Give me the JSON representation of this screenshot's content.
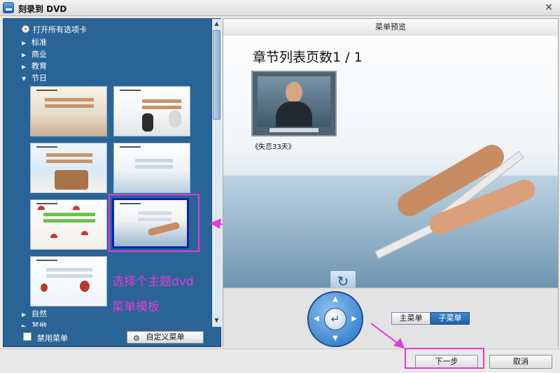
{
  "window": {
    "title": "刻录到 DVD",
    "close": "✕"
  },
  "tree": {
    "open_all": "打开所有选项卡",
    "items": [
      {
        "label": "标准",
        "arrow": "▶"
      },
      {
        "label": "商业",
        "arrow": "▶"
      },
      {
        "label": "教育",
        "arrow": "▶"
      },
      {
        "label": "节日",
        "arrow": "▼"
      }
    ],
    "bottom_items": [
      {
        "label": "自然",
        "arrow": "▶"
      },
      {
        "label": "其他",
        "arrow": "▶"
      }
    ]
  },
  "left_footer": {
    "disable_menu": "禁用菜单",
    "custom_menu": "自定义菜单"
  },
  "annotation": {
    "line1": "选择个主题dvd",
    "line2": "菜单模板"
  },
  "preview": {
    "header": "菜单预览",
    "page_title": "章节列表页数1 / 1",
    "chapter_label": "《失恋33天》",
    "back_icon": "↻"
  },
  "controls": {
    "main_menu": "主菜单",
    "sub_menu": "子菜单",
    "enter_icon": "↵"
  },
  "footer": {
    "next": "下一步",
    "cancel": "取消"
  },
  "colors": {
    "panel": "#2a6496",
    "annotation": "#e23ad8",
    "selection": "#0a23b8"
  }
}
